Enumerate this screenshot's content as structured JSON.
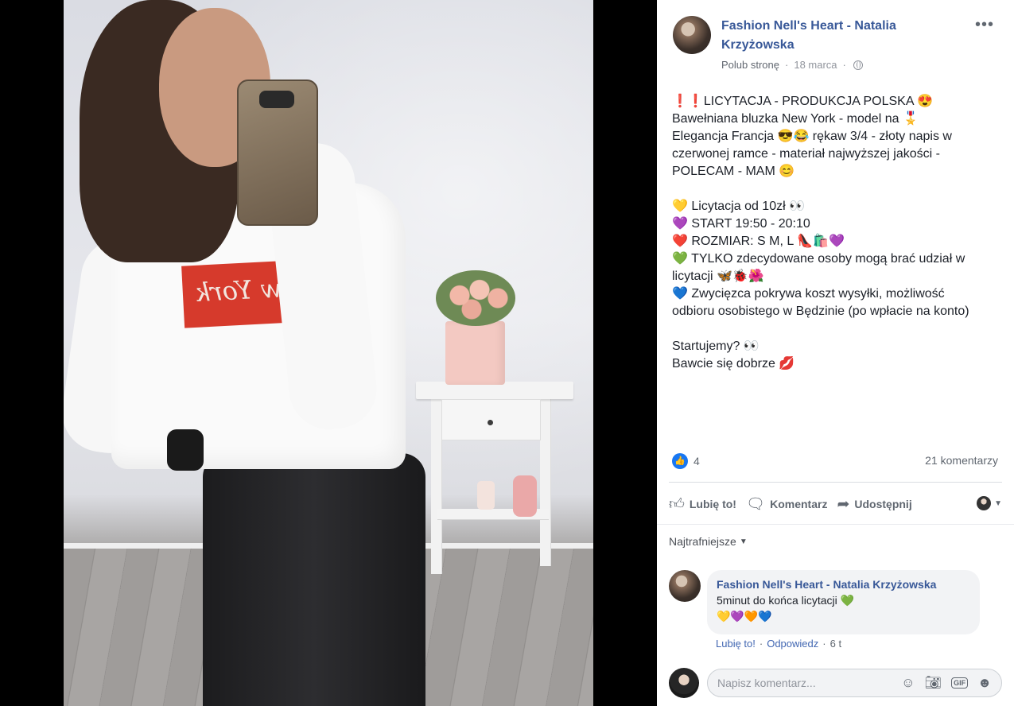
{
  "post": {
    "author": "Fashion Nell's Heart - Natalia Krzyżowska",
    "follow": "Polub stronę",
    "date": "18 marca",
    "lines": [
      "❗❗LICYTACJA - PRODUKCJA POLSKA 😍",
      "Bawełniana bluzka New York - model na 🎖️",
      "Elegancja Francja 😎😂 rękaw 3/4 - złoty napis w",
      "czerwonej ramce - materiał najwyższej jakości -",
      "POLECAM - MAM 😊",
      "",
      "💛 Licytacja od 10zł 👀",
      "💜 START 19:50 - 20:10",
      "❤️ ROZMIAR: S M, L 👠🛍️💜",
      "💚 TYLKO zdecydowane osoby mogą brać udział w",
      "licytacji 🦋🐞🌺",
      "💙 Zwycięzca pokrywa koszt wysyłki, możliwość",
      "odbioru osobistego w Będzinie (po wpłacie na konto)",
      "",
      "Startujemy? 👀",
      "Bawcie się dobrze 💋"
    ]
  },
  "photo": {
    "shirt_print": "New York"
  },
  "reactions": {
    "count": "4",
    "comments": "21 komentarzy"
  },
  "actions": {
    "like": "Lubię to!",
    "comment": "Komentarz",
    "share": "Udostępnij"
  },
  "sort": {
    "label": "Najtrafniejsze"
  },
  "comment": {
    "author": "Fashion Nell's Heart - Natalia Krzyżowska",
    "text": "5minut do końca licytacji 💚",
    "emojis": "💛💜🧡💙",
    "like": "Lubię to!",
    "reply": "Odpowiedz",
    "time": "6 t"
  },
  "composer": {
    "placeholder": "Napisz komentarz..."
  },
  "icons": {
    "like": "thumbs-up-icon",
    "comment": "speech-bubble-icon",
    "share": "share-arrow-icon",
    "emoji": "smiley-icon",
    "camera": "camera-icon",
    "gif": "gif-icon",
    "sticker": "sticker-icon",
    "more": "more-dots-icon",
    "globe": "globe-icon"
  },
  "colors": {
    "link": "#385898",
    "like_badge": "#1877f2",
    "photo_background": "#000000"
  }
}
